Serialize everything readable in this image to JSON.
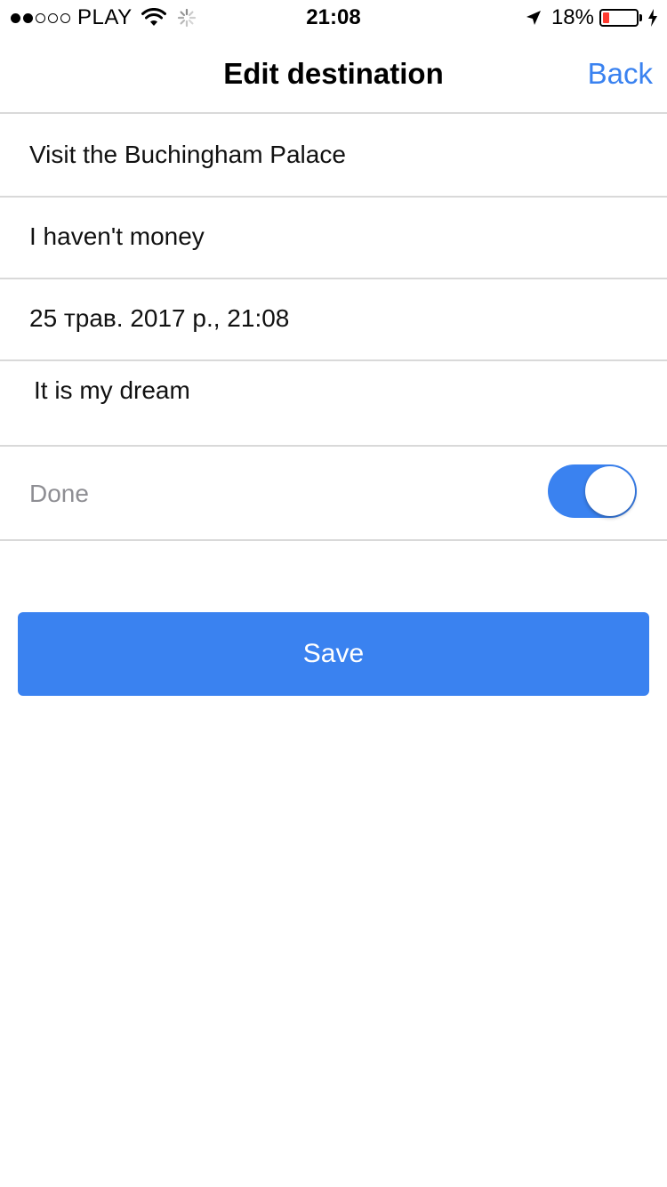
{
  "status_bar": {
    "carrier": "PLAY",
    "time": "21:08",
    "battery_percent": "18%",
    "battery_level": 0.18,
    "signal_bars_filled": 2,
    "signal_bars_total": 5,
    "battery_color": "#ff3b30",
    "icons": [
      "wifi-icon",
      "activity-spinner-icon",
      "location-arrow-icon",
      "battery-icon",
      "charging-bolt-icon"
    ]
  },
  "nav": {
    "title": "Edit destination",
    "back_label": "Back"
  },
  "form": {
    "title_value": "Visit the Buchingham Palace",
    "note_value": "I haven't money",
    "date_value": "25 трав. 2017 р., 21:08",
    "description_value": "It is my dream",
    "done_label": "Done",
    "done_on": true
  },
  "actions": {
    "save_label": "Save"
  },
  "colors": {
    "accent": "#3a82f0",
    "separator": "#d9d9d9",
    "secondary_text": "#8e8e93"
  }
}
